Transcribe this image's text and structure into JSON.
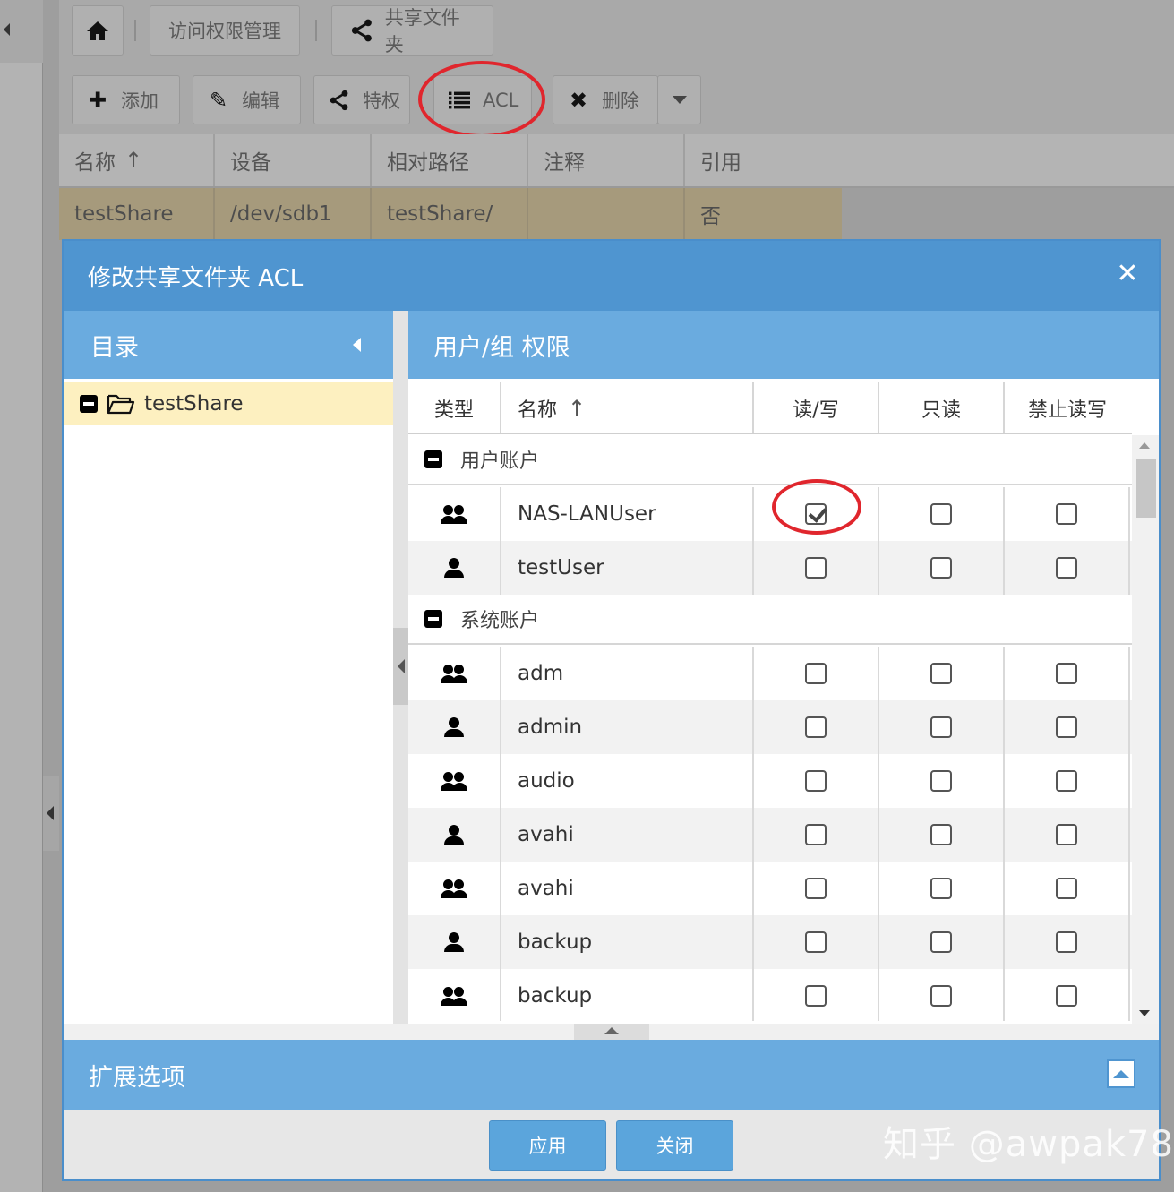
{
  "breadcrumb": {
    "home_icon": "home-icon",
    "item1": "访问权限管理",
    "item2": "共享文件夹"
  },
  "toolbar": {
    "add": "添加",
    "edit": "编辑",
    "privilege": "特权",
    "acl": "ACL",
    "delete": "删除"
  },
  "grid": {
    "columns": [
      "名称",
      "设备",
      "相对路径",
      "注释",
      "引用"
    ],
    "rows": [
      {
        "name": "testShare",
        "device": "/dev/sdb1",
        "path": "testShare/",
        "comment": "",
        "ref": "否"
      }
    ]
  },
  "dialog": {
    "title": "修改共享文件夹 ACL",
    "directory": {
      "header": "目录",
      "item": "testShare"
    },
    "permissions": {
      "header": "用户/组 权限",
      "columns": {
        "type": "类型",
        "name": "名称",
        "rw": "读/写",
        "ro": "只读",
        "deny": "禁止读写"
      },
      "groups": [
        {
          "label": "用户账户",
          "rows": [
            {
              "kind": "group",
              "name": "NAS-LANUser",
              "rw": true,
              "ro": false,
              "deny": false
            },
            {
              "kind": "user",
              "name": "testUser",
              "rw": false,
              "ro": false,
              "deny": false
            }
          ]
        },
        {
          "label": "系统账户",
          "rows": [
            {
              "kind": "group",
              "name": "adm",
              "rw": false,
              "ro": false,
              "deny": false
            },
            {
              "kind": "user",
              "name": "admin",
              "rw": false,
              "ro": false,
              "deny": false
            },
            {
              "kind": "group",
              "name": "audio",
              "rw": false,
              "ro": false,
              "deny": false
            },
            {
              "kind": "user",
              "name": "avahi",
              "rw": false,
              "ro": false,
              "deny": false
            },
            {
              "kind": "group",
              "name": "avahi",
              "rw": false,
              "ro": false,
              "deny": false
            },
            {
              "kind": "user",
              "name": "backup",
              "rw": false,
              "ro": false,
              "deny": false
            },
            {
              "kind": "group",
              "name": "backup",
              "rw": false,
              "ro": false,
              "deny": false
            }
          ]
        }
      ]
    },
    "extended": "扩展选项",
    "apply": "应用",
    "close": "关闭"
  },
  "watermark": "知乎 @awpak78",
  "colors": {
    "dialog_blue": "#4f95d0",
    "panel_blue": "#6aabdf",
    "highlight": "#e0262d",
    "selected_row": "#fdf0c0"
  }
}
